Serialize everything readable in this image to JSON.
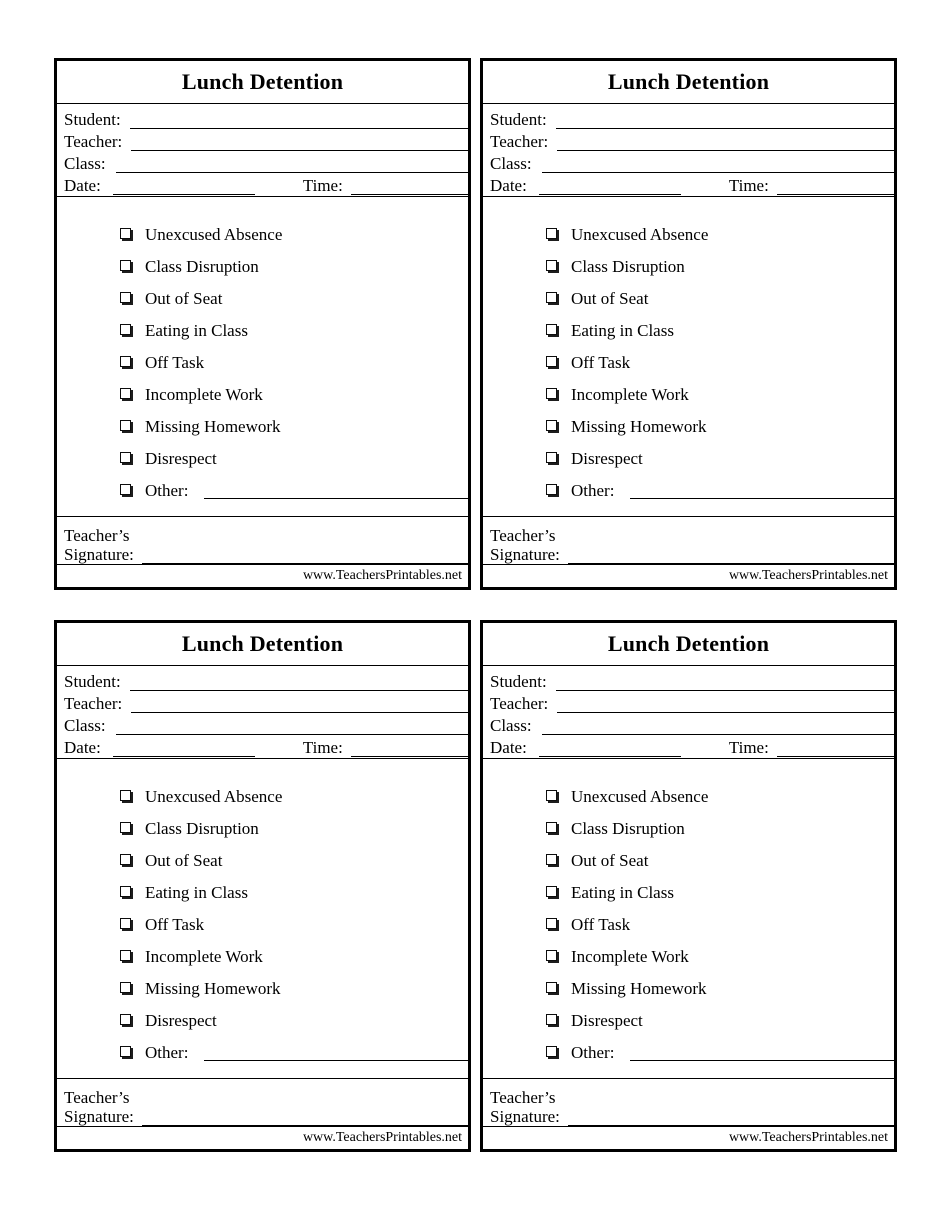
{
  "page": {
    "background": "#ffffff",
    "ink": "#000000",
    "card_count": 4
  },
  "card": {
    "title": "Lunch Detention",
    "fields": [
      {
        "label": "Student:"
      },
      {
        "label": "Teacher:"
      },
      {
        "label": "Class:"
      }
    ],
    "date_row": {
      "date_label": "Date:",
      "time_label": "Time:"
    },
    "checkbox_icon": "checkbox-empty-icon",
    "reasons": [
      "Unexcused Absence",
      "Class Disruption",
      "Out of Seat",
      "Eating in Class",
      "Off Task",
      "Incomplete Work",
      "Missing Homework",
      "Disrespect"
    ],
    "other": {
      "label": "Other:"
    },
    "signature": {
      "line1": "Teacher’s",
      "line2": "Signature:"
    },
    "footer": "www.TeachersPrintables.net"
  }
}
